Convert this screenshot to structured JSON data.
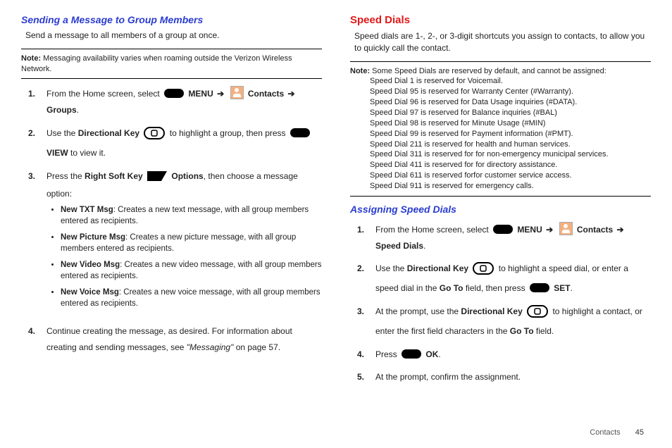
{
  "left": {
    "heading": "Sending a Message to Group Members",
    "intro": "Send a message to all members of a group at once.",
    "note_label": "Note:",
    "note_text": "Messaging availability varies when roaming outside the Verizon Wireless Network.",
    "step1_a": "From the Home screen, select ",
    "step1_menu": "MENU",
    "step1_contacts": "Contacts",
    "step1_groups": "Groups",
    "step2_a": "Use the ",
    "step2_key": "Directional Key",
    "step2_b": " to highlight a group, then press ",
    "step2_view": "VIEW",
    "step2_c": " to view it.",
    "step3_a": "Press the ",
    "step3_key": "Right Soft Key",
    "step3_opt": "Options",
    "step3_b": ", then choose a message option:",
    "bullets": [
      {
        "t": "New TXT Msg",
        "d": ": Creates a new text message, with all group members entered as recipients."
      },
      {
        "t": "New Picture Msg",
        "d": ": Creates a new picture message, with all group members entered as recipients."
      },
      {
        "t": "New Video Msg",
        "d": ": Creates a new video message, with all group members entered as recipients."
      },
      {
        "t": "New Voice Msg",
        "d": ": Creates a new voice message, with all group members entered as recipients."
      }
    ],
    "step4_a": "Continue creating the message, as desired. For information about creating and sending messages, see ",
    "step4_ref": "\"Messaging\"",
    "step4_b": " on page 57."
  },
  "right": {
    "heading": "Speed Dials",
    "intro": "Speed dials are 1-, 2-, or 3-digit shortcuts you assign to contacts, to allow you to quickly call the contact.",
    "note_label": "Note:",
    "note_first": "Some Speed Dials are reserved by default, and cannot be assigned:",
    "note_lines": [
      "Speed Dial 1 is reserved for Voicemail.",
      "Speed Dial 95 is reserved for Warranty Center (#Warranty).",
      "Speed Dial 96 is reserved for Data Usage inquiries (#DATA).",
      "Speed Dial 97 is reserved for Balance inquiries (#BAL)",
      "Speed Dial 98 is reserved for Minute Usage (#MIN)",
      "Speed Dial 99 is reserved for Payment information (#PMT).",
      "Speed Dial 211 is reserved for health and human services.",
      "Speed Dial 311 is reserved for for non-emergency municipal services.",
      "Speed Dial 411 is reserved for for directory assistance.",
      "Speed Dial 611 is reserved forfor customer service access.",
      "Speed Dial 911 is reserved for emergency calls."
    ],
    "sub": "Assigning Speed Dials",
    "s1_a": "From the Home screen, select ",
    "s1_menu": "MENU",
    "s1_contacts": "Contacts",
    "s1_sd": "Speed Dials",
    "s2_a": "Use the ",
    "s2_key": "Directional Key",
    "s2_b": " to highlight a speed dial, or enter a speed dial in the ",
    "s2_goto": "Go To",
    "s2_c": " field, then press ",
    "s2_set": "SET",
    "s3_a": "At the prompt, use the ",
    "s3_key": "Directional Key",
    "s3_b": " to highlight a contact, or enter the first field characters in the ",
    "s3_goto": "Go To",
    "s3_c": " field.",
    "s4_a": "Press ",
    "s4_ok": "OK",
    "s5": "At the prompt, confirm the assignment."
  },
  "footer": {
    "section": "Contacts",
    "page": "45"
  }
}
